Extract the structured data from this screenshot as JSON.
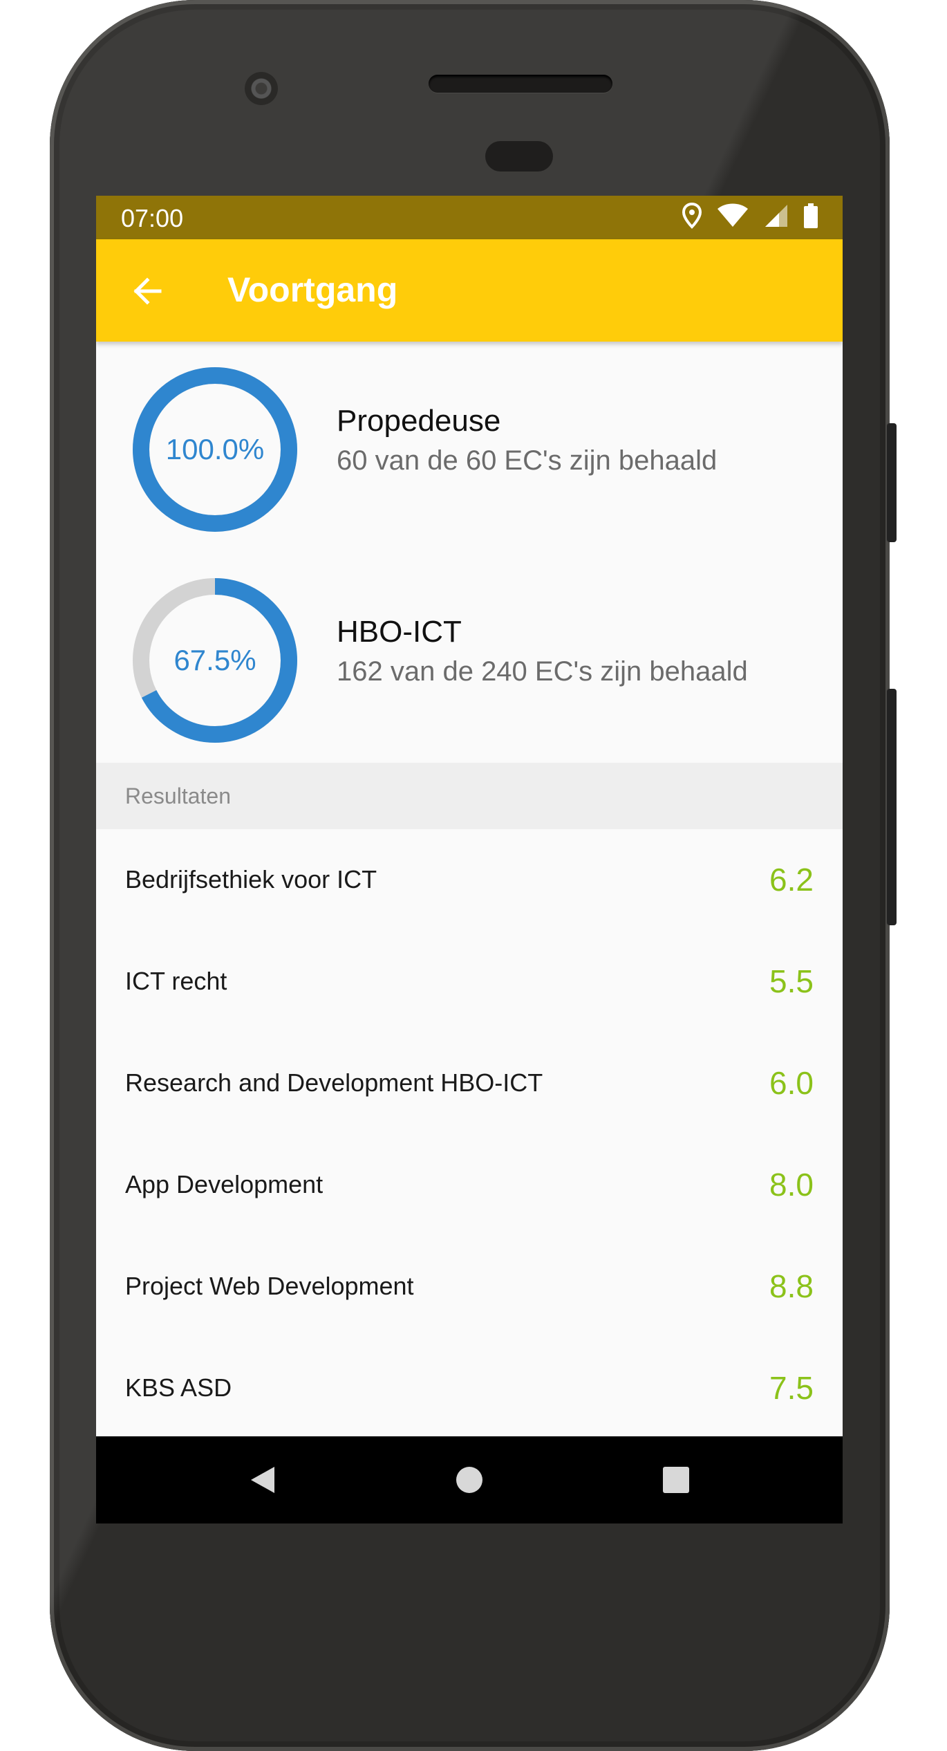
{
  "status_bar": {
    "time": "07:00"
  },
  "app_bar": {
    "title": "Voortgang"
  },
  "progress": [
    {
      "percent_label": "100.0%",
      "fraction": 1.0,
      "title": "Propedeuse",
      "subtitle": "60 van de 60 EC's zijn behaald"
    },
    {
      "percent_label": "67.5%",
      "fraction": 0.675,
      "title": "HBO-ICT",
      "subtitle": "162 van de 240 EC's zijn behaald"
    }
  ],
  "results_section": {
    "header": "Resultaten",
    "items": [
      {
        "name": "Bedrijfsethiek voor ICT",
        "grade": "6.2"
      },
      {
        "name": "ICT recht",
        "grade": "5.5"
      },
      {
        "name": "Research and Development HBO-ICT",
        "grade": "6.0"
      },
      {
        "name": "App Development",
        "grade": "8.0"
      },
      {
        "name": "Project Web Development",
        "grade": "8.8"
      },
      {
        "name": "KBS ASD",
        "grade": "7.5"
      }
    ]
  },
  "colors": {
    "app_bar": "#ffcc0a",
    "status_bar": "#8f7408",
    "ring_progress": "#2f86cf",
    "ring_track": "#d3d3d3",
    "grade": "#8bc21a"
  },
  "icons": {
    "back": "arrow-back-icon",
    "location": "location-icon",
    "wifi": "wifi-icon",
    "signal": "signal-icon",
    "battery": "battery-icon",
    "nav_back": "nav-back-icon",
    "nav_home": "nav-home-icon",
    "nav_recents": "nav-recents-icon"
  }
}
